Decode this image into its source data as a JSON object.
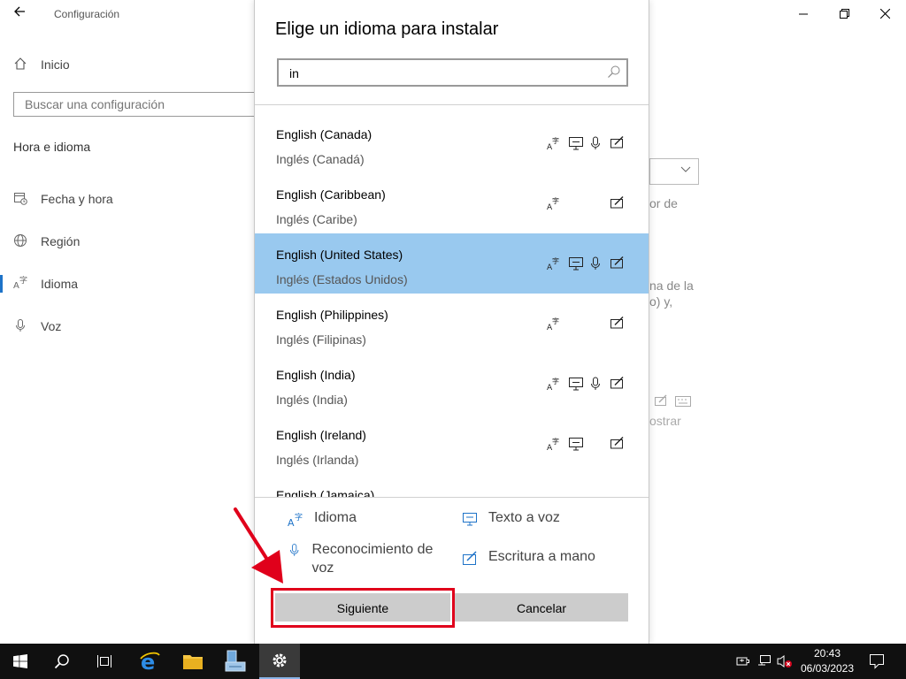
{
  "settings": {
    "title": "Configuración",
    "home_label": "Inicio",
    "search_placeholder": "Buscar una configuración",
    "section": "Hora e idioma",
    "nav": [
      {
        "label": "Fecha y hora",
        "icon": "calendar-clock-icon"
      },
      {
        "label": "Región",
        "icon": "globe-icon"
      },
      {
        "label": "Idioma",
        "icon": "language-icon"
      },
      {
        "label": "Voz",
        "icon": "microphone-icon"
      }
    ],
    "background_fragments": [
      "or de",
      "na de la",
      "o) y,",
      "ostrar"
    ]
  },
  "dialog": {
    "title": "Elige un idioma para instalar",
    "search_value": "in",
    "languages": [
      {
        "name": "English (Canada)",
        "local": "Inglés (Canadá)",
        "features": [
          "display-language",
          "text-to-speech",
          "speech-recognition",
          "handwriting"
        ],
        "selected": false
      },
      {
        "name": "English (Caribbean)",
        "local": "Inglés (Caribe)",
        "features": [
          "display-language",
          "handwriting"
        ],
        "selected": false
      },
      {
        "name": "English (United States)",
        "local": "Inglés (Estados Unidos)",
        "features": [
          "display-language",
          "text-to-speech",
          "speech-recognition",
          "handwriting"
        ],
        "selected": true
      },
      {
        "name": "English (Philippines)",
        "local": "Inglés (Filipinas)",
        "features": [
          "display-language",
          "handwriting"
        ],
        "selected": false
      },
      {
        "name": "English (India)",
        "local": "Inglés (India)",
        "features": [
          "display-language",
          "text-to-speech",
          "speech-recognition",
          "handwriting"
        ],
        "selected": false
      },
      {
        "name": "English (Ireland)",
        "local": "Inglés (Irlanda)",
        "features": [
          "display-language",
          "text-to-speech",
          "handwriting"
        ],
        "selected": false
      },
      {
        "name": "English (Jamaica)",
        "local": "",
        "features": [
          "display-language",
          "handwriting"
        ],
        "selected": false
      }
    ],
    "legend": {
      "language": "Idioma",
      "tts": "Texto a voz",
      "speech": "Reconocimiento de voz",
      "handwriting": "Escritura a mano"
    },
    "next_button": "Siguiente",
    "cancel_button": "Cancelar"
  },
  "taskbar": {
    "time": "20:43",
    "date": "06/03/2023"
  },
  "colors": {
    "selected_row": "#99c9ef",
    "accent": "#1e73c8",
    "annotation_red": "#e0001b",
    "taskbar_bg": "#101010"
  }
}
